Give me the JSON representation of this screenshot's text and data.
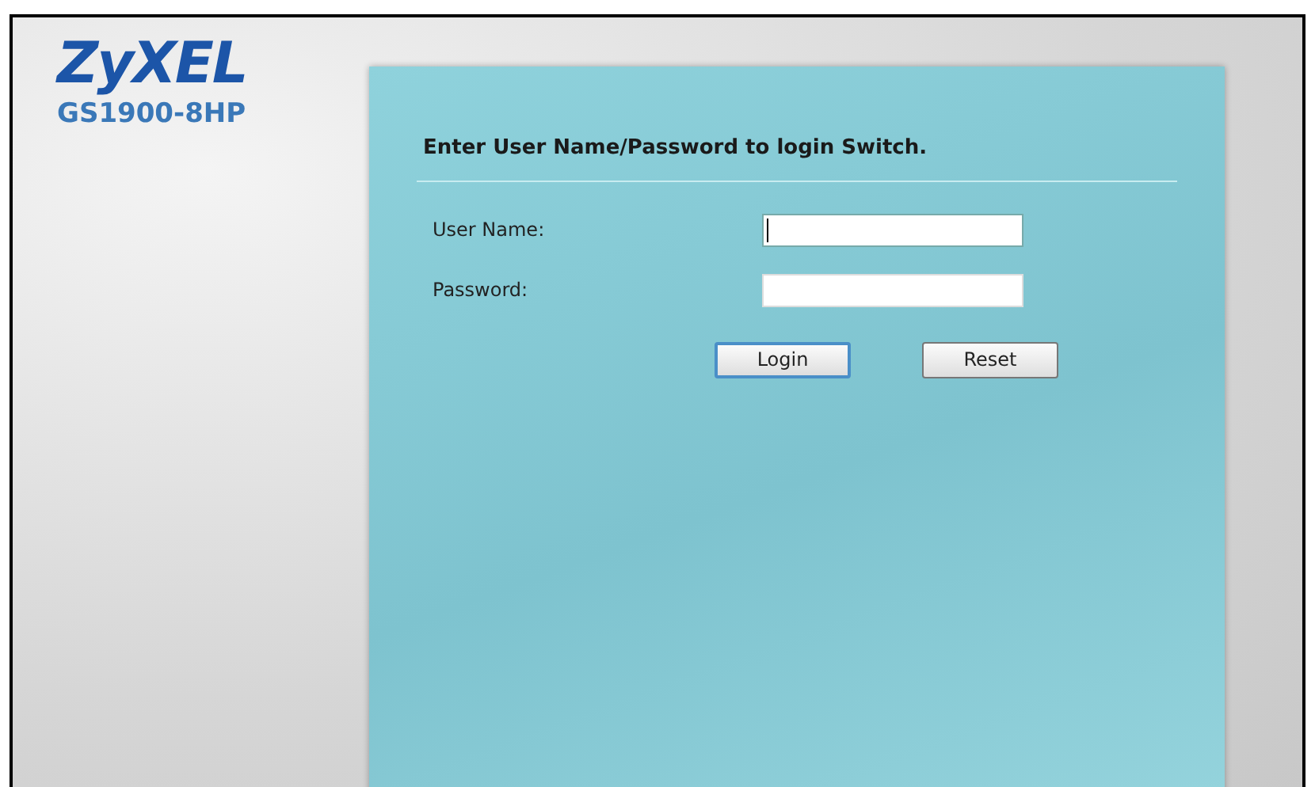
{
  "logo": {
    "brand": "ZyXEL",
    "model": "GS1900-8HP"
  },
  "login": {
    "heading": "Enter User Name/Password to login Switch.",
    "fields": [
      {
        "label": "User Name:",
        "focused": true
      },
      {
        "label": "Password:",
        "focused": false
      }
    ],
    "buttons": [
      {
        "label": "Login",
        "focused": true
      },
      {
        "label": "Reset",
        "focused": false
      }
    ]
  }
}
